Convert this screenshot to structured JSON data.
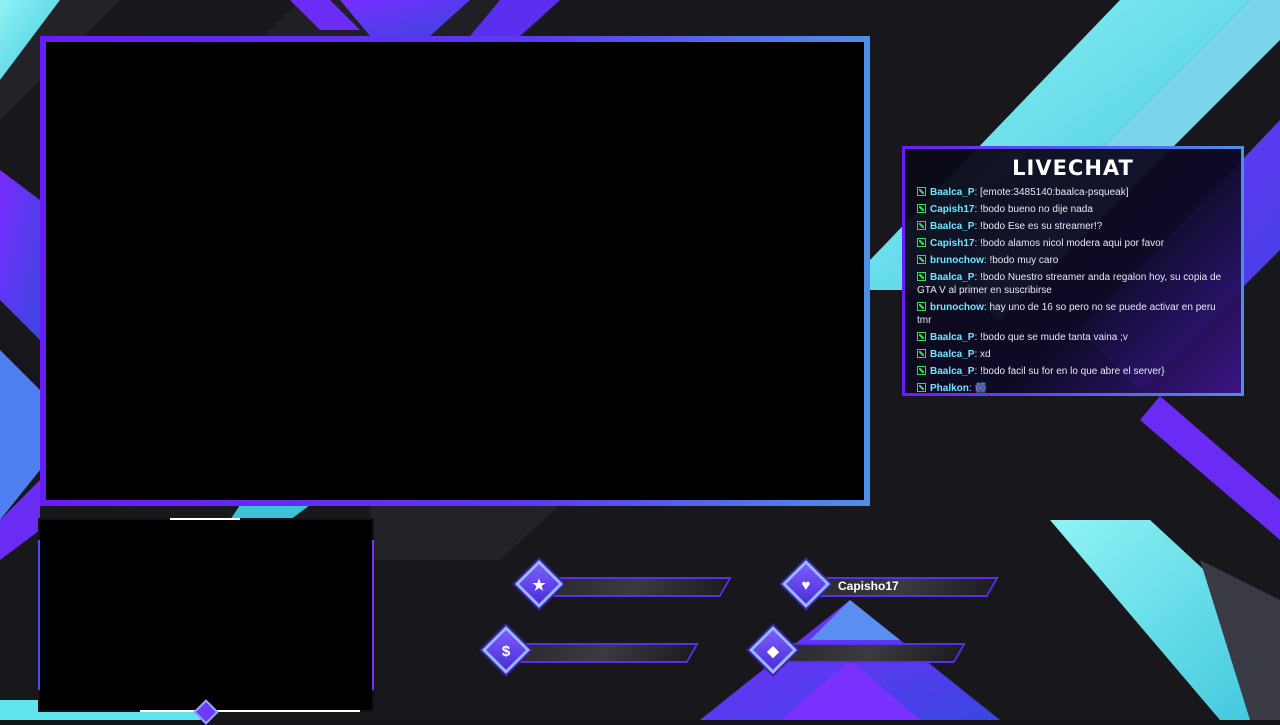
{
  "chat": {
    "title": "LIVECHAT",
    "messages": [
      {
        "user": "Baalca_P",
        "text": ": [emote:3485140:baalca-psqueak]"
      },
      {
        "user": "Capish17",
        "text": ": !bodo bueno no dije nada"
      },
      {
        "user": "Baalca_P",
        "text": ": !bodo Ese es su streamer!?"
      },
      {
        "user": "Capish17",
        "text": ": !bodo alamos nicol modera aqui por favor"
      },
      {
        "user": "brunochow",
        "text": ": !bodo muy caro"
      },
      {
        "user": "Baalca_P",
        "text": ": !bodo Nuestro streamer anda regalon hoy, su copia de GTA V al primer en suscribirse"
      },
      {
        "user": "brunochow",
        "text": ": hay uno de 16 so pero no se puede activar en peru tmr"
      },
      {
        "user": "Baalca_P",
        "text": ": !bodo que se mude tanta vaina ;v"
      },
      {
        "user": "Baalca_P",
        "text": ": xd"
      },
      {
        "user": "Baalca_P",
        "text": ": !bodo facil su for en lo que abre el server}"
      },
      {
        "user": "Phalkon",
        "text": ": 🎆"
      }
    ]
  },
  "widgets": {
    "follower": {
      "icon": "star-icon",
      "glyph": "★",
      "value": ""
    },
    "subscriber": {
      "icon": "heart-icon",
      "glyph": "♥",
      "value": "Capisho17"
    },
    "donation": {
      "icon": "dollar-icon",
      "glyph": "$",
      "value": ""
    },
    "bits": {
      "icon": "diamond-icon",
      "glyph": "◆",
      "value": ""
    }
  },
  "colors": {
    "accent_purple": "#6a1cf7",
    "accent_blue": "#4f8ee6",
    "accent_cyan": "#5fe3ec",
    "username": "#6fe6ff",
    "badge_green": "#34e04a"
  }
}
